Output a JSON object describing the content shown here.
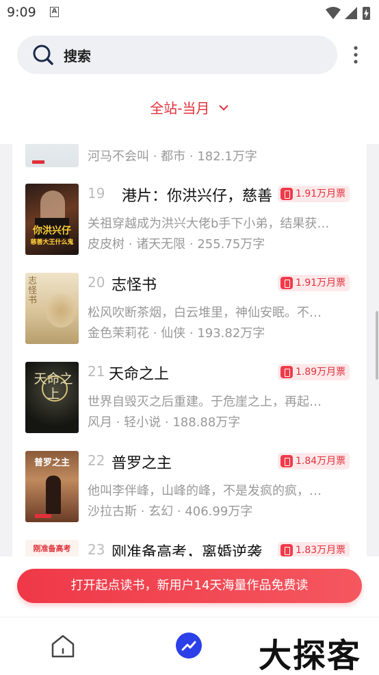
{
  "status_bar": {
    "time": "9:09",
    "notification_icon": "A"
  },
  "search": {
    "label": "搜索"
  },
  "filter": {
    "label": "全站-当月"
  },
  "books": [
    {
      "rank": "",
      "title": "",
      "desc": "",
      "meta": "河马不会叫 · 都市 · 182.1万字",
      "votes": ""
    },
    {
      "rank": "19",
      "title": "港片：你洪兴仔，慈善",
      "desc": "关祖穿越成为洪兴大佬b手下小弟，结果获…",
      "meta": "皮皮树 · 诸天无限 · 255.75万字",
      "votes": "1.91万月票",
      "cover_text_main": "你洪兴仔",
      "cover_text_sub": "慈善大王什么鬼"
    },
    {
      "rank": "20",
      "title": "志怪书",
      "desc": "松风吹断茶烟，白云堆里，神仙安眠。不…",
      "meta": "金色茉莉花 · 仙侠 · 193.82万字",
      "votes": "1.91万月票",
      "cover_text_main": "志怪书"
    },
    {
      "rank": "21",
      "title": "天命之上",
      "desc": "世界自毁灭之后重建。于危崖之上，再起…",
      "meta": "风月 · 轻小说 · 188.88万字",
      "votes": "1.89万月票",
      "cover_text_main": "天命之上"
    },
    {
      "rank": "22",
      "title": "普罗之主",
      "desc": "他叫李伴峰，山峰的峰，不是发疯的疯，…",
      "meta": "沙拉古斯 · 玄幻 · 406.99万字",
      "votes": "1.84万月票",
      "cover_text_main": "普罗之主"
    },
    {
      "rank": "23",
      "title": "刚准备高考，离婚逆袭",
      "desc": "",
      "meta": "",
      "votes": "1.83万月票",
      "cover_text_main": "刚准备高考"
    }
  ],
  "promo": {
    "label": "打开起点读书，新用户14天海量作品免费读"
  },
  "watermark": "大探客",
  "colors": {
    "accent": "#e0303a",
    "tab_active": "#2b40e8"
  }
}
